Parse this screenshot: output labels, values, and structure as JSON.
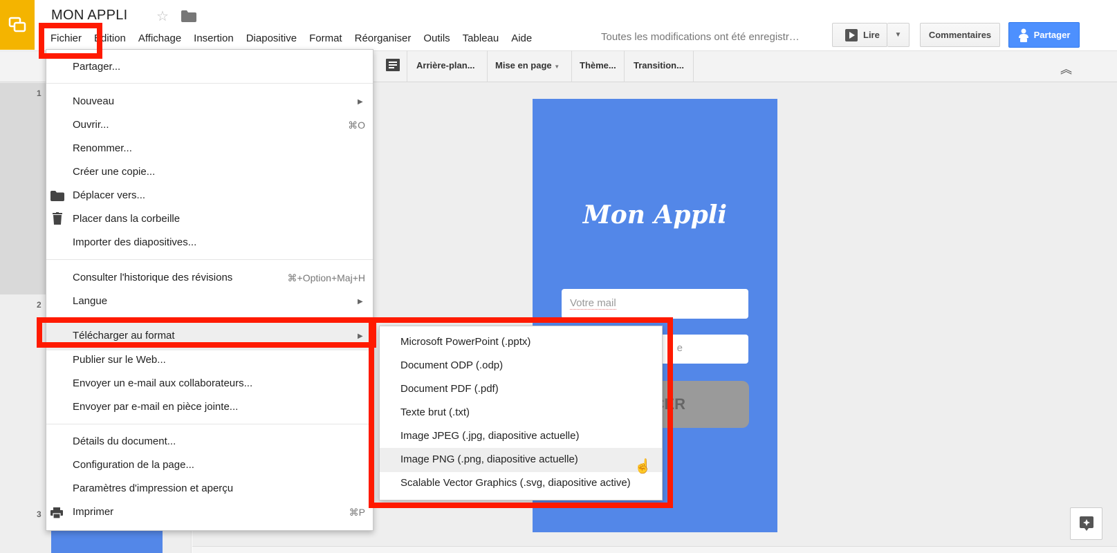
{
  "header": {
    "title": "MON APPLI",
    "save_status": "Toutes les modifications ont été enregistr…",
    "lire_label": "Lire",
    "comments_label": "Commentaires",
    "share_label": "Partager"
  },
  "menubar": [
    "Fichier",
    "Édition",
    "Affichage",
    "Insertion",
    "Diapositive",
    "Format",
    "Réorganiser",
    "Outils",
    "Tableau",
    "Aide"
  ],
  "toolbar": {
    "background": "Arrière-plan...",
    "layout": "Mise en page",
    "theme": "Thème...",
    "transition": "Transition..."
  },
  "filmstrip": {
    "slide_numbers": [
      "1",
      "2",
      "3"
    ]
  },
  "slide": {
    "title": "Mon Appli",
    "email_placeholder": "Votre mail",
    "password_partial": "e",
    "button_partial": "CER"
  },
  "file_menu": {
    "items": [
      {
        "label": "Partager..."
      },
      {
        "label": "Nouveau",
        "submenu": true
      },
      {
        "label": "Ouvrir...",
        "shortcut": "⌘O"
      },
      {
        "label": "Renommer..."
      },
      {
        "label": "Créer une copie..."
      },
      {
        "label": "Déplacer vers...",
        "icon": "folder-icon"
      },
      {
        "label": "Placer dans la corbeille",
        "icon": "trash-icon"
      },
      {
        "label": "Importer des diapositives..."
      },
      {
        "label": "Consulter l'historique des révisions",
        "shortcut": "⌘+Option+Maj+H"
      },
      {
        "label": "Langue",
        "submenu": true
      },
      {
        "label": "Télécharger au format",
        "submenu": true,
        "highlighted": true
      },
      {
        "label": "Publier sur le Web..."
      },
      {
        "label": "Envoyer un e-mail aux collaborateurs..."
      },
      {
        "label": "Envoyer par e-mail en pièce jointe..."
      },
      {
        "label": "Détails du document..."
      },
      {
        "label": "Configuration de la page..."
      },
      {
        "label": "Paramètres d'impression et aperçu"
      },
      {
        "label": "Imprimer",
        "shortcut": "⌘P",
        "icon": "print-icon"
      }
    ]
  },
  "download_submenu": {
    "items": [
      {
        "label": "Microsoft PowerPoint (.pptx)"
      },
      {
        "label": "Document ODP (.odp)"
      },
      {
        "label": "Document PDF (.pdf)"
      },
      {
        "label": "Texte brut (.txt)"
      },
      {
        "label": "Image JPEG (.jpg, diapositive actuelle)"
      },
      {
        "label": "Image PNG (.png, diapositive actuelle)",
        "hovered": true
      },
      {
        "label": "Scalable Vector Graphics (.svg, diapositive active)"
      }
    ]
  },
  "colors": {
    "app_yellow": "#f4b400",
    "share_blue": "#4d90fe",
    "slide_blue": "#5387e8",
    "annotation_red": "#ff1a00"
  }
}
